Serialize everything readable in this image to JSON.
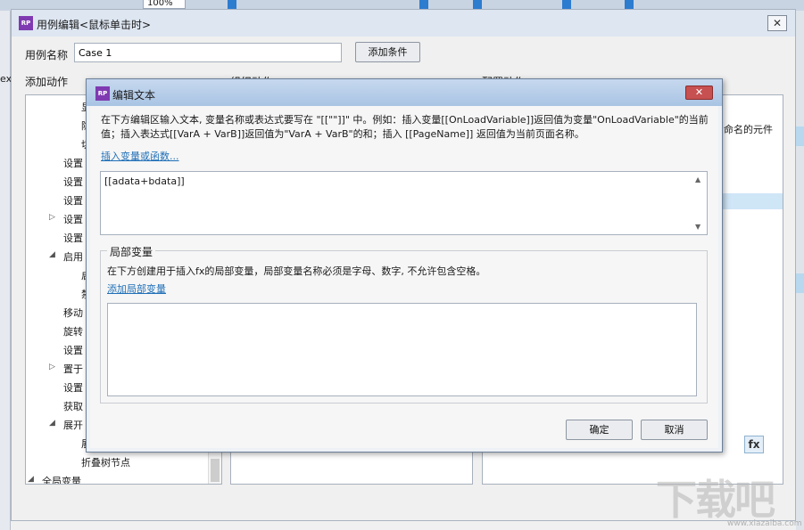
{
  "background_app": {
    "zoom": "100%",
    "left_edge_text": "ex"
  },
  "outer_dialog": {
    "title": "用例编辑<鼠标单击时>",
    "close_glyph": "✕",
    "case_name_label": "用例名称",
    "case_name_value": "Case 1",
    "add_condition_label": "添加条件",
    "add_action_label": "添加动作",
    "organize_actions_label": "组织动作",
    "configure_actions_label": "配置动作",
    "named_widgets_text": "命名的元件",
    "fx_label": "fx",
    "tree_items": [
      {
        "label": "显",
        "indent": 2
      },
      {
        "label": "隐",
        "indent": 2
      },
      {
        "label": "切",
        "indent": 2
      },
      {
        "label": "设置",
        "indent": 1
      },
      {
        "label": "设置",
        "indent": 1
      },
      {
        "label": "设置",
        "indent": 1
      },
      {
        "label": "设置",
        "indent": 1,
        "arrow": "▷"
      },
      {
        "label": "设置",
        "indent": 1
      },
      {
        "label": "启用",
        "indent": 1,
        "arrow": "◢"
      },
      {
        "label": "启",
        "indent": 2
      },
      {
        "label": "禁",
        "indent": 2
      },
      {
        "label": "移动",
        "indent": 1
      },
      {
        "label": "旋转",
        "indent": 1
      },
      {
        "label": "设置",
        "indent": 1
      },
      {
        "label": "置于",
        "indent": 1,
        "arrow": "▷"
      },
      {
        "label": "设置",
        "indent": 1
      },
      {
        "label": "获取",
        "indent": 1
      },
      {
        "label": "展开",
        "indent": 1,
        "arrow": "◢"
      },
      {
        "label": "展",
        "indent": 2
      },
      {
        "label": "折叠树节点",
        "indent": 2
      },
      {
        "label": "全局变量",
        "indent": 0,
        "arrow": "◢"
      }
    ]
  },
  "edit_text_dialog": {
    "title": "编辑文本",
    "close_glyph": "✕",
    "instructions": "在下方编辑区输入文本, 变量名称或表达式要写在 \"[[\"\"]]\" 中。例如：插入变量[[OnLoadVariable]]返回值为变量\"OnLoadVariable\"的当前值；插入表达式[[VarA + VarB]]返回值为\"VarA + VarB\"的和；插入 [[PageName]] 返回值为当前页面名称。",
    "insert_link": "插入变量或函数...",
    "text_value": "[[adata+bdata]]",
    "local_vars_legend": "局部变量",
    "local_vars_desc": "在下方创建用于插入fx的局部变量，局部变量名称必须是字母、数字, 不允许包含空格。",
    "add_local_var_link": "添加局部变量",
    "ok_label": "确定",
    "cancel_label": "取消"
  },
  "watermark": {
    "text": "下载吧",
    "sub": "www.xiazaiba.com"
  },
  "colors": {
    "logo_purple": "#7f3ab1",
    "link_blue": "#1f6fb7",
    "close_red": "#c75050",
    "selection_blue": "#cfe6f7"
  }
}
